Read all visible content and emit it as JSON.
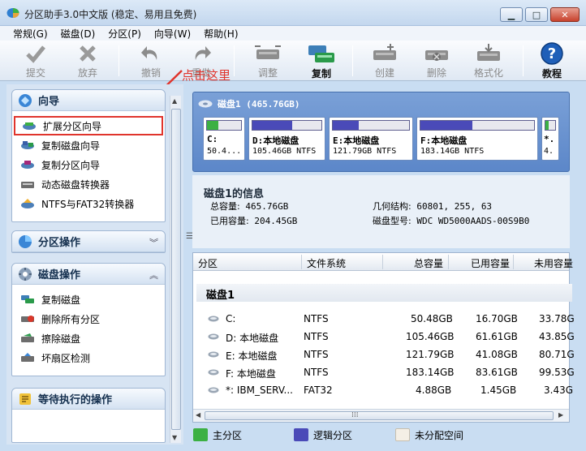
{
  "window": {
    "title": "分区助手3.0中文版 (稳定、易用且免费)"
  },
  "menu": [
    "常规(G)",
    "磁盘(D)",
    "分区(P)",
    "向导(W)",
    "帮助(H)"
  ],
  "toolbar": {
    "submit": "提交",
    "discard": "放弃",
    "undo": "撤销",
    "redo": "重做",
    "adjust": "调整",
    "copy": "复制",
    "create": "创建",
    "delete": "删除",
    "format": "格式化",
    "tutorial": "教程"
  },
  "annotation": "点击这里",
  "sidebar": {
    "wizard": {
      "title": "向导",
      "items": [
        "扩展分区向导",
        "复制磁盘向导",
        "复制分区向导",
        "动态磁盘转换器",
        "NTFS与FAT32转换器"
      ]
    },
    "partition_ops": {
      "title": "分区操作"
    },
    "disk_ops": {
      "title": "磁盘操作",
      "items": [
        "复制磁盘",
        "删除所有分区",
        "擦除磁盘",
        "坏扇区检测"
      ]
    },
    "pending": {
      "title": "等待执行的操作"
    }
  },
  "diskmap": {
    "title": "磁盘1 (465.76GB)",
    "partitions": [
      {
        "name": "C:",
        "info": "50.4...",
        "used_fraction": 0.33,
        "color": "#3cb043"
      },
      {
        "name": "D:本地磁盘",
        "info": "105.46GB NTFS",
        "used_fraction": 0.58,
        "color": "#4a4ab8"
      },
      {
        "name": "E:本地磁盘",
        "info": "121.79GB NTFS",
        "used_fraction": 0.34,
        "color": "#4a4ab8"
      },
      {
        "name": "F:本地磁盘",
        "info": "183.14GB NTFS",
        "used_fraction": 0.46,
        "color": "#4a4ab8"
      },
      {
        "name": "*.",
        "info": "4.",
        "used_fraction": 0.3,
        "color": "#3cb043"
      }
    ]
  },
  "diskinfo": {
    "title": "磁盘1的信息",
    "total_label": "总容量:",
    "total_value": "465.76GB",
    "used_label": "已用容量:",
    "used_value": "204.45GB",
    "geometry_label": "几何结构:",
    "geometry_value": "60801, 255, 63",
    "model_label": "磁盘型号:",
    "model_value": "WDC WD5000AADS-00S9B0"
  },
  "table": {
    "headers": [
      "分区",
      "文件系统",
      "总容量",
      "已用容量",
      "未用容量"
    ],
    "group": "磁盘1",
    "rows": [
      [
        "C:",
        "NTFS",
        "50.48GB",
        "16.70GB",
        "33.78G"
      ],
      [
        "D: 本地磁盘",
        "NTFS",
        "105.46GB",
        "61.61GB",
        "43.85G"
      ],
      [
        "E: 本地磁盘",
        "NTFS",
        "121.79GB",
        "41.08GB",
        "80.71G"
      ],
      [
        "F: 本地磁盘",
        "NTFS",
        "183.14GB",
        "83.61GB",
        "99.53G"
      ],
      [
        "*: IBM_SERV...",
        "FAT32",
        "4.88GB",
        "1.45GB",
        "3.43G"
      ]
    ]
  },
  "legend": {
    "primary": "主分区",
    "primary_color": "#3cb043",
    "logical": "逻辑分区",
    "logical_color": "#4a4ab8",
    "unallocated": "未分配空间",
    "unallocated_color": "#f4efe6"
  }
}
